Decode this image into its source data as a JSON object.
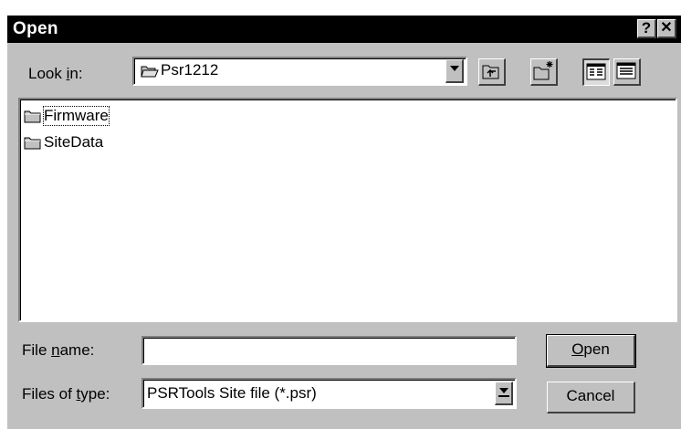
{
  "window": {
    "title": "Open",
    "help_label": "?",
    "close_label": "✕"
  },
  "lookin": {
    "label_pre": "Look ",
    "label_key": "i",
    "label_post": "n:",
    "value": "Psr1212"
  },
  "toolbar": {
    "icons": [
      "up-one-level-icon",
      "create-new-folder-icon",
      "list-view-icon",
      "details-view-icon"
    ]
  },
  "files": [
    {
      "name": "Firmware",
      "icon": "folder-icon"
    },
    {
      "name": "SiteData",
      "icon": "folder-icon"
    }
  ],
  "filename": {
    "label_pre": "File ",
    "label_key": "n",
    "label_post": "ame:",
    "value": ""
  },
  "filetype": {
    "label_pre": "Files of ",
    "label_key": "t",
    "label_post": "ype:",
    "value": "PSRTools Site file (*.psr)"
  },
  "buttons": {
    "open_key": "O",
    "open_rest": "pen",
    "cancel": "Cancel"
  },
  "colors": {
    "face": "#c0c0c0",
    "titlebar": "#000000"
  }
}
